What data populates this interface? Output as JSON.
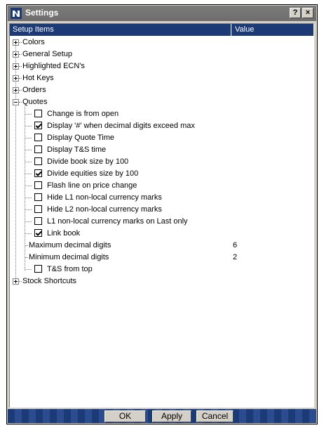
{
  "window": {
    "title": "Settings",
    "help_label": "?",
    "close_label": "×"
  },
  "header": {
    "items": "Setup Items",
    "value": "Value"
  },
  "tree": [
    {
      "label": "Colors",
      "expander": "+"
    },
    {
      "label": "General Setup",
      "expander": "+"
    },
    {
      "label": "Highlighted ECN's",
      "expander": "+"
    },
    {
      "label": "Hot Keys",
      "expander": "+"
    },
    {
      "label": "Orders",
      "expander": "+"
    },
    {
      "label": "Quotes",
      "expander": "-"
    },
    {
      "label": "Change is from open",
      "checked": false
    },
    {
      "label": "Display '#' when decimal digits exceed max",
      "checked": true
    },
    {
      "label": "Display Quote Time",
      "checked": false
    },
    {
      "label": "Display T&S time",
      "checked": false
    },
    {
      "label": "Divide book size by 100",
      "checked": false
    },
    {
      "label": "Divide equities size by 100",
      "checked": true
    },
    {
      "label": "Flash line on price change",
      "checked": false
    },
    {
      "label": "Hide L1 non-local currency marks",
      "checked": false
    },
    {
      "label": "Hide L2 non-local currency marks",
      "checked": false
    },
    {
      "label": "L1 non-local currency marks on Last only",
      "checked": false
    },
    {
      "label": "Link book",
      "checked": true
    },
    {
      "label": "Maximum decimal digits",
      "value": "6"
    },
    {
      "label": "Minimum decimal digits",
      "value": "2"
    },
    {
      "label": "T&S from top",
      "checked": false
    },
    {
      "label": "Stock Shortcuts",
      "expander": "+"
    }
  ],
  "footer": {
    "ok": "OK",
    "apply": "Apply",
    "cancel": "Cancel"
  }
}
